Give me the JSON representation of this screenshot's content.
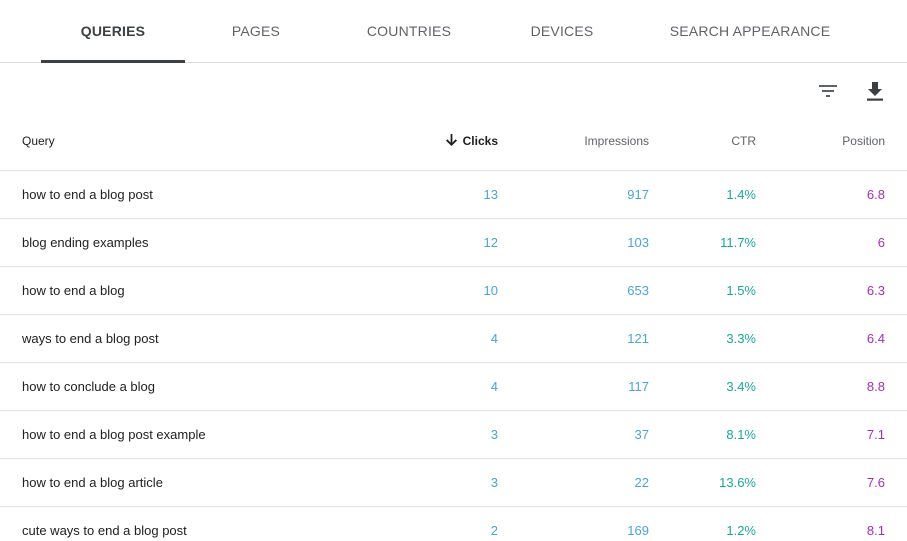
{
  "tabs": [
    {
      "label": "QUERIES",
      "active": true
    },
    {
      "label": "PAGES",
      "active": false
    },
    {
      "label": "COUNTRIES",
      "active": false
    },
    {
      "label": "DEVICES",
      "active": false
    },
    {
      "label": "SEARCH APPEARANCE",
      "active": false
    }
  ],
  "toolbar": {
    "filter_icon": "filter-icon",
    "download_icon": "download-icon"
  },
  "table": {
    "columns": {
      "query": "Query",
      "clicks": "Clicks",
      "impressions": "Impressions",
      "ctr": "CTR",
      "position": "Position"
    },
    "sort_icon": "arrow-down-icon",
    "rows": [
      {
        "query": "how to end a blog post",
        "clicks": "13",
        "impressions": "917",
        "ctr": "1.4%",
        "position": "6.8"
      },
      {
        "query": "blog ending examples",
        "clicks": "12",
        "impressions": "103",
        "ctr": "11.7%",
        "position": "6"
      },
      {
        "query": "how to end a blog",
        "clicks": "10",
        "impressions": "653",
        "ctr": "1.5%",
        "position": "6.3"
      },
      {
        "query": "ways to end a blog post",
        "clicks": "4",
        "impressions": "121",
        "ctr": "3.3%",
        "position": "6.4"
      },
      {
        "query": "how to conclude a blog",
        "clicks": "4",
        "impressions": "117",
        "ctr": "3.4%",
        "position": "8.8"
      },
      {
        "query": "how to end a blog post example",
        "clicks": "3",
        "impressions": "37",
        "ctr": "8.1%",
        "position": "7.1"
      },
      {
        "query": "how to end a blog article",
        "clicks": "3",
        "impressions": "22",
        "ctr": "13.6%",
        "position": "7.6"
      },
      {
        "query": "cute ways to end a blog post",
        "clicks": "2",
        "impressions": "169",
        "ctr": "1.2%",
        "position": "8.1"
      }
    ]
  },
  "colors": {
    "clicks": "#4aa3df",
    "impressions": "#4aa3df",
    "ctr": "#1ba39c",
    "position": "#a72bbf",
    "active_tab": "#3c4043"
  }
}
